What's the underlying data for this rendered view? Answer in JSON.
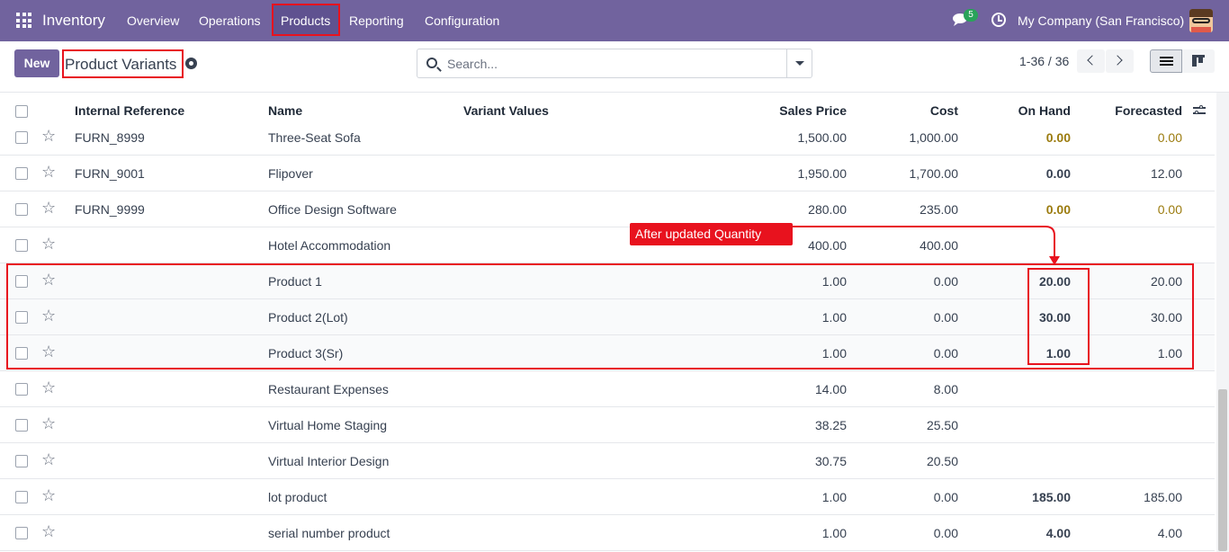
{
  "navbar": {
    "app_name": "Inventory",
    "menu": [
      "Overview",
      "Operations",
      "Products",
      "Reporting",
      "Configuration"
    ],
    "chat_badge": "5",
    "company": "My Company (San Francisco)"
  },
  "control": {
    "new_label": "New",
    "title": "Product Variants",
    "search_placeholder": "Search...",
    "pager": "1-36 / 36"
  },
  "table": {
    "headers": {
      "ref": "Internal Reference",
      "name": "Name",
      "variant": "Variant Values",
      "sales": "Sales Price",
      "cost": "Cost",
      "onhand": "On Hand",
      "forecast": "Forecasted"
    },
    "rows": [
      {
        "ref": "FURN_8999",
        "name": "Three-Seat Sofa",
        "sales": "1,500.00",
        "cost": "1,000.00",
        "onhand": "0.00",
        "forecast": "0.00"
      },
      {
        "ref": "FURN_9001",
        "name": "Flipover",
        "sales": "1,950.00",
        "cost": "1,700.00",
        "onhand": "0.00",
        "forecast": "12.00"
      },
      {
        "ref": "FURN_9999",
        "name": "Office Design Software",
        "sales": "280.00",
        "cost": "235.00",
        "onhand": "0.00",
        "forecast": "0.00"
      },
      {
        "ref": "",
        "name": "Hotel Accommodation",
        "sales": "400.00",
        "cost": "400.00",
        "onhand": "",
        "forecast": ""
      },
      {
        "ref": "",
        "name": "Product 1",
        "sales": "1.00",
        "cost": "0.00",
        "onhand": "20.00",
        "forecast": "20.00"
      },
      {
        "ref": "",
        "name": "Product 2(Lot)",
        "sales": "1.00",
        "cost": "0.00",
        "onhand": "30.00",
        "forecast": "30.00"
      },
      {
        "ref": "",
        "name": "Product 3(Sr)",
        "sales": "1.00",
        "cost": "0.00",
        "onhand": "1.00",
        "forecast": "1.00"
      },
      {
        "ref": "",
        "name": "Restaurant Expenses",
        "sales": "14.00",
        "cost": "8.00",
        "onhand": "",
        "forecast": ""
      },
      {
        "ref": "",
        "name": "Virtual Home Staging",
        "sales": "38.25",
        "cost": "25.50",
        "onhand": "",
        "forecast": ""
      },
      {
        "ref": "",
        "name": "Virtual Interior Design",
        "sales": "30.75",
        "cost": "20.50",
        "onhand": "",
        "forecast": ""
      },
      {
        "ref": "",
        "name": "lot product",
        "sales": "1.00",
        "cost": "0.00",
        "onhand": "185.00",
        "forecast": "185.00"
      },
      {
        "ref": "",
        "name": "serial number product",
        "sales": "1.00",
        "cost": "0.00",
        "onhand": "4.00",
        "forecast": "4.00"
      }
    ]
  },
  "annotation": {
    "label": "After updated Quantity"
  },
  "colors": {
    "navbar": "#71639e",
    "annotation": "#e8121e",
    "warning_text": "#9b7b0e"
  }
}
